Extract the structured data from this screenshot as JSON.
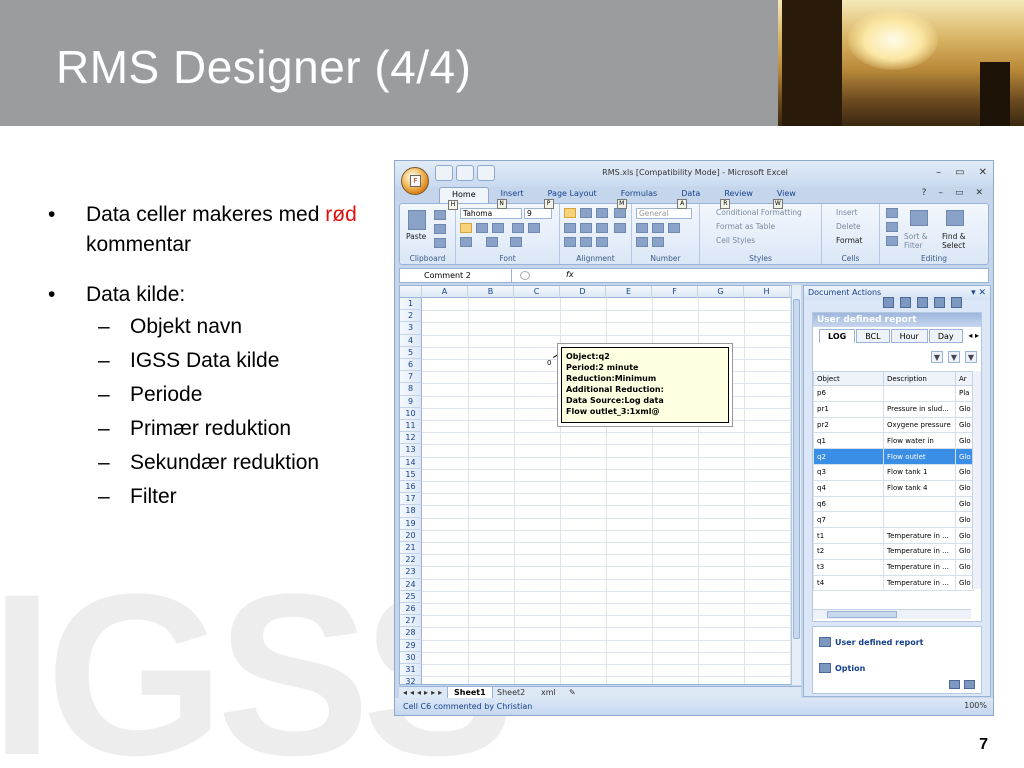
{
  "slide": {
    "title": "RMS Designer (4/4)",
    "number": "7",
    "watermark": "IGSS"
  },
  "bullets": [
    {
      "parts": [
        "Data celler makeres med ",
        "rød",
        " kommentar"
      ],
      "highlight_color": "#e01010"
    },
    {
      "text": "Data kilde:",
      "subitems": [
        "Objekt navn",
        "IGSS Data kilde",
        "Periode",
        "Primær reduktion",
        "Sekundær reduktion",
        "Filter"
      ]
    }
  ],
  "excel": {
    "window_title": "RMS.xls  [Compatibility Mode] - Microsoft Excel",
    "qat_keys": [
      "1",
      "2",
      "3"
    ],
    "tabs": [
      {
        "label": "Home",
        "key": "H"
      },
      {
        "label": "Insert",
        "key": "N"
      },
      {
        "label": "Page Layout",
        "key": "P"
      },
      {
        "label": "Formulas",
        "key": "M"
      },
      {
        "label": "Data",
        "key": "A"
      },
      {
        "label": "Review",
        "key": "R"
      },
      {
        "label": "View",
        "key": "W"
      }
    ],
    "ribbon": {
      "clipboard": {
        "label": "Clipboard",
        "paste": "Paste"
      },
      "font": {
        "label": "Font",
        "name": "Tahoma",
        "size": "9"
      },
      "alignment": {
        "label": "Alignment"
      },
      "number": {
        "label": "Number",
        "format": "General"
      },
      "styles": {
        "label": "Styles",
        "conditional": "Conditional Formatting",
        "table": "Format as Table",
        "cell": "Cell Styles"
      },
      "cells": {
        "label": "Cells",
        "insert": "Insert",
        "delete": "Delete",
        "format": "Format"
      },
      "editing": {
        "label": "Editing",
        "sort": "Sort & Filter",
        "find": "Find & Select"
      }
    },
    "name_box": "Comment 2",
    "fx": "fx",
    "columns": [
      "A",
      "B",
      "C",
      "D",
      "E",
      "F",
      "G",
      "H"
    ],
    "rows": [
      "1",
      "2",
      "3",
      "4",
      "5",
      "6",
      "7",
      "8",
      "9",
      "10",
      "11",
      "12",
      "13",
      "14",
      "15",
      "16",
      "17",
      "18",
      "19",
      "20",
      "21",
      "22",
      "23",
      "24",
      "25",
      "26",
      "27",
      "28",
      "29",
      "30",
      "31",
      "32"
    ],
    "comment_marker": "0",
    "comment_lines": [
      "Object:q2",
      "Period:2 minute",
      "Reduction:Minimum",
      "Additional Reduction:",
      "Data Source:Log data",
      "Flow outlet_3:1xml@"
    ],
    "sheet_tabs": [
      "Sheet1",
      "Sheet2",
      "xml"
    ],
    "active_sheet": "Sheet1",
    "status": "Cell C6 commented by Christian",
    "zoom": "100%"
  },
  "pane": {
    "title": "Document Actions",
    "report_title": "User defined report",
    "tabs": [
      "LOG",
      "BCL",
      "Hour",
      "Day"
    ],
    "active_tab": "LOG",
    "columns": [
      "Object",
      "Description",
      "Ar"
    ],
    "rows": [
      [
        "p6",
        "",
        "Pla"
      ],
      [
        "pr1",
        "Pressure in slud...",
        "Glo"
      ],
      [
        "pr2",
        "Oxygene pressure",
        "Glo"
      ],
      [
        "q1",
        "Flow  water in",
        "Glo"
      ],
      [
        "q2",
        "Flow outlet",
        "Glo"
      ],
      [
        "q3",
        "Flow tank 1",
        "Glo"
      ],
      [
        "q4",
        "Flow tank 4",
        "Glo"
      ],
      [
        "q6",
        "",
        "Glo"
      ],
      [
        "q7",
        "",
        "Glo"
      ],
      [
        "t1",
        "Temperature in ...",
        "Glo"
      ],
      [
        "t2",
        "Temperature in ...",
        "Glo"
      ],
      [
        "t3",
        "Temperature in ...",
        "Glo"
      ],
      [
        "t4",
        "Temperature in ...",
        "Glo"
      ]
    ],
    "selected_row": 4,
    "links": [
      "User defined report",
      "Option"
    ]
  }
}
